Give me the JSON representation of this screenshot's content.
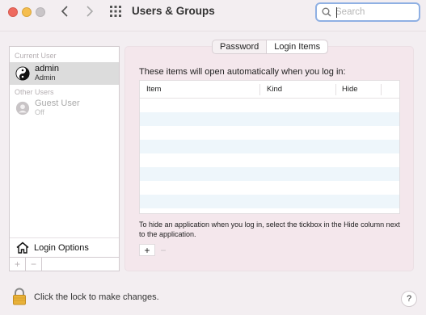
{
  "window": {
    "title": "Users & Groups"
  },
  "search": {
    "placeholder": "Search",
    "value": ""
  },
  "sidebar": {
    "current_header": "Current User",
    "other_header": "Other Users",
    "current_user": {
      "name": "admin",
      "role": "Admin",
      "icon": "yin-yang-icon"
    },
    "other_users": [
      {
        "name": "Guest User",
        "status": "Off",
        "icon": "person-icon"
      }
    ],
    "login_options_label": "Login Options",
    "add_label": "+",
    "remove_label": "−"
  },
  "tabs": [
    {
      "label": "Password",
      "active": false
    },
    {
      "label": "Login Items",
      "active": true
    }
  ],
  "panel": {
    "description": "These items will open automatically when you log in:",
    "columns": [
      "Item",
      "Kind",
      "Hide"
    ],
    "rows": [],
    "hint": "To hide an application when you log in, select the tickbox in the Hide column next to the application.",
    "add_label": "+",
    "remove_label": "−"
  },
  "footer": {
    "lock_text": "Click the lock to make changes.",
    "help_label": "?"
  },
  "colors": {
    "close": "#ee6a5f",
    "minimize": "#f5be4f",
    "search_focus": "#8fb0e3",
    "panel_bg": "#f4e7ec",
    "row_alt": "#eef6fb"
  }
}
